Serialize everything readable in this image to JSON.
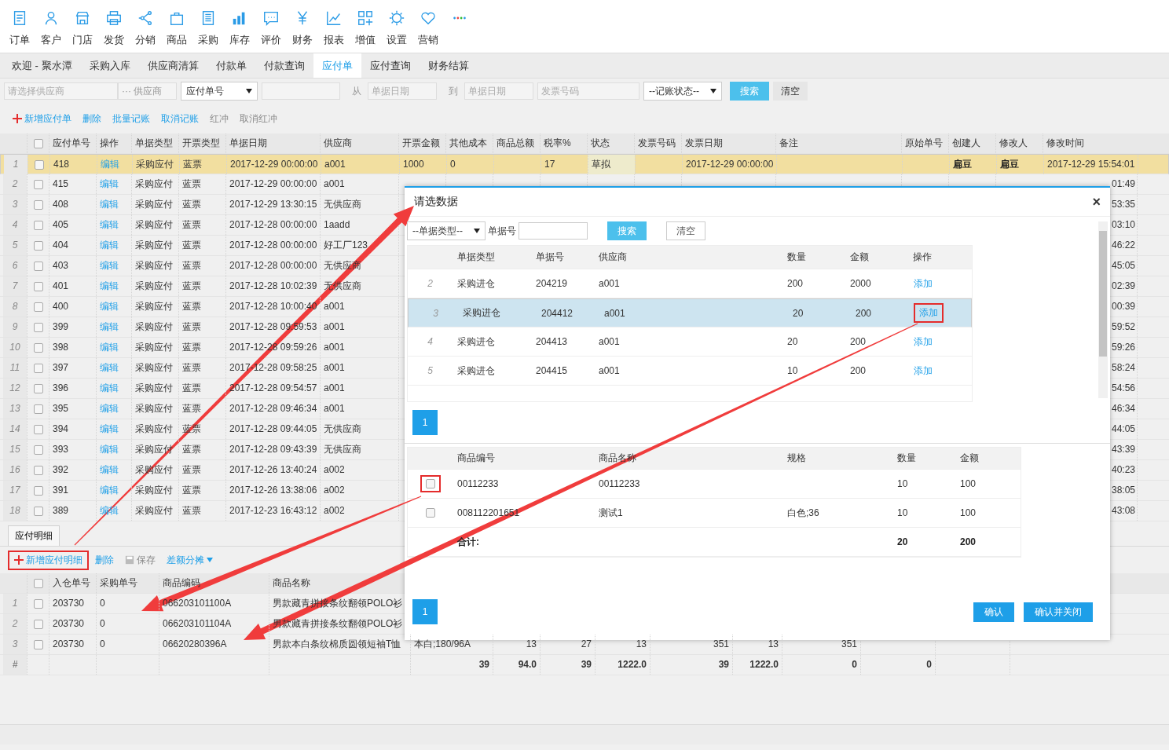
{
  "nav": [
    "订单",
    "客户",
    "门店",
    "发货",
    "分销",
    "商品",
    "采购",
    "库存",
    "评价",
    "财务",
    "报表",
    "增值",
    "设置",
    "营销"
  ],
  "tabs": [
    {
      "label": "欢迎 - 聚水潭",
      "selected": false
    },
    {
      "label": "采购入库",
      "selected": false
    },
    {
      "label": "供应商清算",
      "selected": false
    },
    {
      "label": "付款单",
      "selected": false
    },
    {
      "label": "付款查询",
      "selected": false
    },
    {
      "label": "应付单",
      "selected": true
    },
    {
      "label": "应付查询",
      "selected": false
    },
    {
      "label": "财务结算",
      "selected": false
    }
  ],
  "filters": {
    "supplier_placeholder": "请选择供应商",
    "supplier_button": "··· 供应商",
    "number_select": "应付单号",
    "from": "从",
    "date_from_placeholder": "单据日期",
    "to": "到",
    "date_to_placeholder": "单据日期",
    "invoice_placeholder": "发票号码",
    "status_select": "--记账状态--",
    "search": "搜索",
    "clear": "清空"
  },
  "toolbar": [
    {
      "label": "新增应付单",
      "kind": "add",
      "disabled": false
    },
    {
      "label": "删除",
      "kind": "plain",
      "disabled": false
    },
    {
      "label": "批量记账",
      "kind": "plain",
      "disabled": false
    },
    {
      "label": "取消记账",
      "kind": "plain",
      "disabled": false
    },
    {
      "label": "红冲",
      "kind": "plain",
      "disabled": true
    },
    {
      "label": "取消红冲",
      "kind": "plain",
      "disabled": true
    }
  ],
  "table": {
    "header_checked": false,
    "columns": [
      "应付单号",
      "操作",
      "单据类型",
      "开票类型",
      "单据日期",
      "供应商",
      "开票金额",
      "其他成本",
      "商品总额",
      "税率%",
      "状态",
      "发票号码",
      "发票日期",
      "备注",
      "原始单号",
      "创建人",
      "修改人",
      "修改时间"
    ],
    "rows": [
      {
        "n": "1",
        "checked": false,
        "selected": true,
        "no": "418",
        "op": "编辑",
        "type": "采购应付",
        "invoice_type": "蓝票",
        "date": "2017-12-29 00:00:00",
        "supplier": "a001",
        "amount": "1000",
        "other_cost": "0",
        "tax_rate": "17",
        "status": {
          "label": "草拟",
          "color": "#eeebcc"
        },
        "invoice_date": "2017-12-29 00:00:00",
        "creator": "扁豆",
        "modifier": "扁豆",
        "modified": "2017-12-29 15:54:01"
      },
      {
        "n": "2",
        "checked": false,
        "selected": false,
        "no": "415",
        "op": "编辑",
        "type": "采购应付",
        "invoice_type": "蓝票",
        "date": "2017-12-29 00:00:00",
        "supplier": "a001",
        "modified_tail": "01:49"
      },
      {
        "n": "3",
        "checked": false,
        "selected": false,
        "no": "408",
        "op": "编辑",
        "type": "采购应付",
        "invoice_type": "蓝票",
        "date": "2017-12-29 13:30:15",
        "supplier": "无供应商",
        "modified_tail": "53:35"
      },
      {
        "n": "4",
        "checked": false,
        "selected": false,
        "no": "405",
        "op": "编辑",
        "type": "采购应付",
        "invoice_type": "蓝票",
        "date": "2017-12-28 00:00:00",
        "supplier": "1aadd",
        "modified_tail": "03:10"
      },
      {
        "n": "5",
        "checked": false,
        "selected": false,
        "no": "404",
        "op": "编辑",
        "type": "采购应付",
        "invoice_type": "蓝票",
        "date": "2017-12-28 00:00:00",
        "supplier": "好工厂123",
        "modified_tail": "46:22"
      },
      {
        "n": "6",
        "checked": false,
        "selected": false,
        "no": "403",
        "op": "编辑",
        "type": "采购应付",
        "invoice_type": "蓝票",
        "date": "2017-12-28 00:00:00",
        "supplier": "无供应商",
        "modified_tail": "45:05"
      },
      {
        "n": "7",
        "checked": false,
        "selected": false,
        "no": "401",
        "op": "编辑",
        "type": "采购应付",
        "invoice_type": "蓝票",
        "date": "2017-12-28 10:02:39",
        "supplier": "无供应商",
        "modified_tail": "02:39"
      },
      {
        "n": "8",
        "checked": false,
        "selected": false,
        "no": "400",
        "op": "编辑",
        "type": "采购应付",
        "invoice_type": "蓝票",
        "date": "2017-12-28 10:00:40",
        "supplier": "a001",
        "modified_tail": "00:39"
      },
      {
        "n": "9",
        "checked": false,
        "selected": false,
        "no": "399",
        "op": "编辑",
        "type": "采购应付",
        "invoice_type": "蓝票",
        "date": "2017-12-28 09:59:53",
        "supplier": "a001",
        "modified_tail": "59:52"
      },
      {
        "n": "10",
        "checked": false,
        "selected": false,
        "no": "398",
        "op": "编辑",
        "type": "采购应付",
        "invoice_type": "蓝票",
        "date": "2017-12-28 09:59:26",
        "supplier": "a001",
        "modified_tail": "59:26"
      },
      {
        "n": "11",
        "checked": false,
        "selected": false,
        "no": "397",
        "op": "编辑",
        "type": "采购应付",
        "invoice_type": "蓝票",
        "date": "2017-12-28 09:58:25",
        "supplier": "a001",
        "modified_tail": "58:24"
      },
      {
        "n": "12",
        "checked": false,
        "selected": false,
        "no": "396",
        "op": "编辑",
        "type": "采购应付",
        "invoice_type": "蓝票",
        "date": "2017-12-28 09:54:57",
        "supplier": "a001",
        "modified_tail": "54:56"
      },
      {
        "n": "13",
        "checked": false,
        "selected": false,
        "no": "395",
        "op": "编辑",
        "type": "采购应付",
        "invoice_type": "蓝票",
        "date": "2017-12-28 09:46:34",
        "supplier": "a001",
        "modified_tail": "46:34"
      },
      {
        "n": "14",
        "checked": false,
        "selected": false,
        "no": "394",
        "op": "编辑",
        "type": "采购应付",
        "invoice_type": "蓝票",
        "date": "2017-12-28 09:44:05",
        "supplier": "无供应商",
        "modified_tail": "44:05"
      },
      {
        "n": "15",
        "checked": false,
        "selected": false,
        "no": "393",
        "op": "编辑",
        "type": "采购应付",
        "invoice_type": "蓝票",
        "date": "2017-12-28 09:43:39",
        "supplier": "无供应商",
        "modified_tail": "43:39"
      },
      {
        "n": "16",
        "checked": false,
        "selected": false,
        "no": "392",
        "op": "编辑",
        "type": "采购应付",
        "invoice_type": "蓝票",
        "date": "2017-12-26 13:40:24",
        "supplier": "a002",
        "modified_tail": "40:23"
      },
      {
        "n": "17",
        "checked": false,
        "selected": false,
        "no": "391",
        "op": "编辑",
        "type": "采购应付",
        "invoice_type": "蓝票",
        "date": "2017-12-26 13:38:06",
        "supplier": "a002",
        "modified_tail": "38:05"
      },
      {
        "n": "18",
        "checked": false,
        "selected": false,
        "no": "389",
        "op": "编辑",
        "type": "采购应付",
        "invoice_type": "蓝票",
        "date": "2017-12-23 16:43:12",
        "supplier": "a002",
        "modified_tail": "43:08"
      }
    ]
  },
  "detail": {
    "tab": "应付明细",
    "toolbar": [
      {
        "label": "新增应付明细",
        "kind": "add",
        "highlighted": true
      },
      {
        "label": "删除",
        "kind": "plain",
        "highlighted": false
      },
      {
        "label": "保存",
        "kind": "save",
        "highlighted": false
      },
      {
        "label": "差额分摊",
        "kind": "dropdown",
        "highlighted": false
      }
    ],
    "header_checked": false,
    "columns": [
      "入仓单号",
      "采购单号",
      "商品编码",
      "商品名称"
    ],
    "rows": [
      {
        "n": "1",
        "checked": false,
        "inbound": "203730",
        "purchase": "0",
        "code": "066203101100A",
        "name": "男款藏青拼接条纹翻领POLO衫"
      },
      {
        "n": "2",
        "checked": false,
        "inbound": "203730",
        "purchase": "0",
        "code": "066203101104A",
        "name": "男款藏青拼接条纹翻领POLO衫"
      },
      {
        "n": "3",
        "checked": false,
        "inbound": "203730",
        "purchase": "0",
        "code": "06620280396A",
        "name": "男款本白条纹棉质圆领短袖T恤",
        "extra": [
          "本白;180/96A",
          "13",
          "27",
          "13",
          "351",
          "13",
          "351"
        ]
      }
    ],
    "footer": {
      "mark": "#",
      "totals": [
        "39",
        "94.0",
        "39",
        "1222.0",
        "39",
        "1222.0",
        "0",
        "0"
      ]
    }
  },
  "modal": {
    "title": "请选数据",
    "close": "×",
    "type_select": "--单据类型--",
    "number_label": "单据号",
    "search": "搜索",
    "clear": "清空",
    "upper": {
      "columns": [
        "单据类型",
        "单据号",
        "供应商",
        "数量",
        "金额",
        "操作"
      ],
      "rows": [
        {
          "n": "2",
          "type": "采购进仓",
          "no": "204219",
          "supplier": "a001",
          "qty": "200",
          "amount": "2000",
          "action": "添加",
          "selected": false,
          "highlighted": false
        },
        {
          "n": "3",
          "type": "采购进仓",
          "no": "204412",
          "supplier": "a001",
          "qty": "20",
          "amount": "200",
          "action": "添加",
          "selected": true,
          "highlighted": true
        },
        {
          "n": "4",
          "type": "采购进仓",
          "no": "204413",
          "supplier": "a001",
          "qty": "20",
          "amount": "200",
          "action": "添加",
          "selected": false,
          "highlighted": false
        },
        {
          "n": "5",
          "type": "采购进仓",
          "no": "204415",
          "supplier": "a001",
          "qty": "10",
          "amount": "200",
          "action": "添加",
          "selected": false,
          "highlighted": false
        }
      ],
      "page": "1"
    },
    "lower": {
      "columns": [
        "商品编号",
        "商品名称",
        "规格",
        "数量",
        "金额"
      ],
      "rows": [
        {
          "checked": false,
          "highlighted": true,
          "code": "00112233",
          "name": "00112233",
          "qty": "10",
          "amount": "100"
        },
        {
          "checked": false,
          "highlighted": false,
          "code": "008112201651",
          "name": "测试1",
          "spec": "白色;36",
          "qty": "10",
          "amount": "100"
        }
      ],
      "total": {
        "label": "合计:",
        "qty": "20",
        "amount": "200"
      }
    },
    "page": "1",
    "buttons": [
      "确认",
      "确认并关闭"
    ]
  }
}
